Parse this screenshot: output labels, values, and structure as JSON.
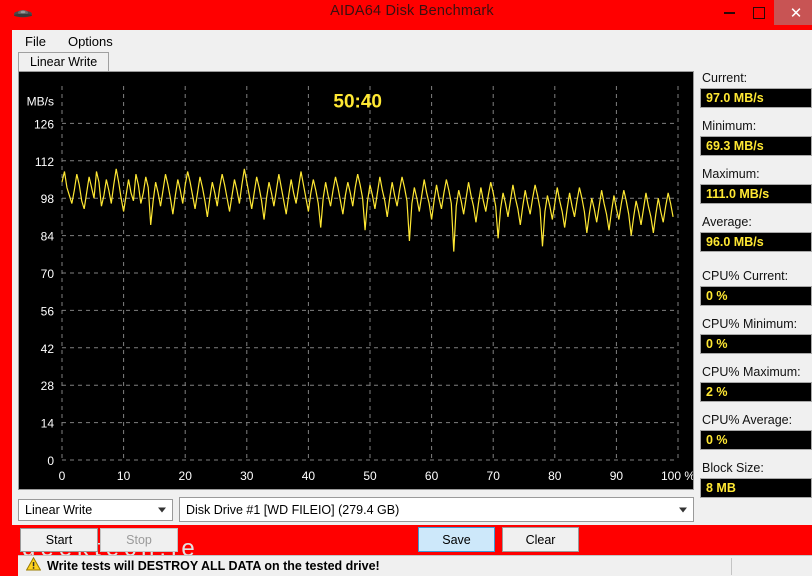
{
  "window": {
    "title": "AIDA64 Disk Benchmark",
    "app_icon": "aida64-icon",
    "minimize_label": "",
    "maximize_label": "",
    "close_label": "✕",
    "titlebar_color": "#ff0000",
    "close_button_color": "#c85454"
  },
  "menu": {
    "items": [
      {
        "label": "File"
      },
      {
        "label": "Options"
      }
    ]
  },
  "tabs": [
    {
      "label": "Linear Write",
      "active": true
    }
  ],
  "graph": {
    "timer": "50:40",
    "timer_color": "#ffe833",
    "plot_color": "#ffe833",
    "background_color": "#000000",
    "grid_color": "#808080",
    "axis_text_color": "#ffffff"
  },
  "chart_data": {
    "type": "line",
    "title": "",
    "xlabel": "100 %",
    "ylabel": "MB/s",
    "xlim": [
      0,
      100
    ],
    "ylim": [
      0,
      140
    ],
    "grid": true,
    "legend_position": "none",
    "xticks": [
      "0",
      "10",
      "20",
      "30",
      "40",
      "50",
      "60",
      "70",
      "80",
      "90",
      "100 %"
    ],
    "xtick_values": [
      0,
      10,
      20,
      30,
      40,
      50,
      60,
      70,
      80,
      90,
      100
    ],
    "yticks": [
      "0",
      "14",
      "28",
      "42",
      "56",
      "70",
      "84",
      "98",
      "112",
      "126"
    ],
    "ytick_values": [
      0,
      14,
      28,
      42,
      56,
      70,
      84,
      98,
      112,
      126
    ],
    "annotations": [
      {
        "text": "50:40",
        "x": 48,
        "y": 132,
        "color": "#ffe833"
      }
    ],
    "series": [
      {
        "name": "Linear Write",
        "color": "#ffe833",
        "x": [
          0,
          0.4,
          0.8,
          1.2,
          1.6,
          2,
          2.4,
          2.8,
          3.2,
          3.6,
          4,
          4.4,
          4.8,
          5.2,
          5.6,
          6,
          6.4,
          6.8,
          7.2,
          7.6,
          8,
          8.4,
          8.8,
          9.2,
          9.6,
          10,
          10.4,
          10.8,
          11.2,
          11.6,
          12,
          12.4,
          12.8,
          13.2,
          13.6,
          14,
          14.4,
          14.8,
          15.2,
          15.6,
          16,
          16.4,
          16.8,
          17.2,
          17.6,
          18,
          18.4,
          18.8,
          19.2,
          19.6,
          20,
          20.4,
          20.8,
          21.2,
          21.6,
          22,
          22.4,
          22.8,
          23.2,
          23.6,
          24,
          24.4,
          24.8,
          25.2,
          25.6,
          26,
          26.4,
          26.8,
          27.2,
          27.6,
          28,
          28.4,
          28.8,
          29.2,
          29.6,
          30,
          30.4,
          30.8,
          31.2,
          31.6,
          32,
          32.4,
          32.8,
          33.2,
          33.6,
          34,
          34.4,
          34.8,
          35.2,
          35.6,
          36,
          36.4,
          36.8,
          37.2,
          37.6,
          38,
          38.4,
          38.8,
          39.2,
          39.6,
          40,
          40.4,
          40.8,
          41.2,
          41.6,
          42,
          42.4,
          42.8,
          43.2,
          43.6,
          44,
          44.4,
          44.8,
          45.2,
          45.6,
          46,
          46.4,
          46.8,
          47.2,
          47.6,
          48,
          48.4,
          48.8,
          49.2,
          49.6,
          50,
          50.4,
          50.8,
          51.2,
          51.6,
          52,
          52.4,
          52.8,
          53.2,
          53.6,
          54,
          54.4,
          54.8,
          55.2,
          55.6,
          56,
          56.4,
          56.8,
          57.2,
          57.6,
          58,
          58.4,
          58.8,
          59.2,
          59.6,
          60,
          60.4,
          60.8,
          61.2,
          61.6,
          62,
          62.4,
          62.8,
          63.2,
          63.6,
          64,
          64.4,
          64.8,
          65.2,
          65.6,
          66,
          66.4,
          66.8,
          67.2,
          67.6,
          68,
          68.4,
          68.8,
          69.2,
          69.6,
          70,
          70.4,
          70.8,
          71.2,
          71.6,
          72,
          72.4,
          72.8,
          73.2,
          73.6,
          74,
          74.4,
          74.8,
          75.2,
          75.6,
          76,
          76.4,
          76.8,
          77.2,
          77.6,
          78,
          78.4,
          78.8,
          79.2,
          79.6,
          80,
          80.4,
          80.8,
          81.2,
          81.6,
          82,
          82.4,
          82.8,
          83.2,
          83.6,
          84,
          84.4,
          84.8,
          85.2,
          85.6,
          86,
          86.4,
          86.8,
          87.2,
          87.6,
          88,
          88.4,
          88.8,
          89.2,
          89.6,
          90,
          90.4,
          90.8,
          91.2,
          91.6,
          92,
          92.4,
          92.8,
          93.2,
          93.6,
          94,
          94.4,
          94.8,
          95.2,
          95.6,
          96,
          96.4,
          96.8,
          97.2,
          97.6,
          98,
          98.4,
          98.8,
          99.2,
          99.6,
          100
        ],
        "y": [
          104,
          108,
          102,
          99,
          96,
          101,
          107,
          103,
          97,
          94,
          100,
          106,
          102,
          98,
          108,
          104,
          95,
          99,
          105,
          101,
          96,
          103,
          109,
          104,
          98,
          93,
          99,
          105,
          100,
          97,
          107,
          103,
          96,
          100,
          106,
          102,
          88,
          97,
          104,
          100,
          95,
          101,
          107,
          103,
          98,
          92,
          99,
          105,
          101,
          96,
          103,
          108,
          104,
          99,
          94,
          100,
          106,
          102,
          97,
          91,
          98,
          104,
          100,
          95,
          102,
          107,
          103,
          98,
          93,
          99,
          105,
          101,
          96,
          103,
          109,
          104,
          99,
          94,
          100,
          106,
          102,
          97,
          90,
          98,
          104,
          100,
          95,
          101,
          107,
          102,
          97,
          92,
          99,
          105,
          100,
          96,
          102,
          108,
          103,
          98,
          93,
          100,
          105,
          101,
          96,
          87,
          98,
          104,
          99,
          95,
          101,
          106,
          102,
          97,
          92,
          99,
          104,
          100,
          95,
          102,
          107,
          103,
          98,
          86,
          97,
          103,
          99,
          94,
          100,
          106,
          101,
          97,
          91,
          98,
          104,
          99,
          95,
          101,
          106,
          102,
          97,
          82,
          96,
          102,
          98,
          93,
          99,
          105,
          100,
          96,
          90,
          97,
          103,
          98,
          94,
          100,
          105,
          101,
          96,
          78,
          95,
          101,
          97,
          92,
          98,
          104,
          99,
          95,
          89,
          96,
          102,
          97,
          93,
          99,
          104,
          100,
          95,
          83,
          94,
          100,
          96,
          91,
          97,
          103,
          98,
          94,
          88,
          95,
          101,
          96,
          92,
          98,
          103,
          99,
          94,
          80,
          93,
          99,
          95,
          90,
          96,
          102,
          97,
          93,
          87,
          94,
          100,
          95,
          91,
          97,
          102,
          98,
          93,
          85,
          92,
          98,
          94,
          89,
          95,
          101,
          96,
          92,
          86,
          93,
          99,
          94,
          90,
          96,
          101,
          97,
          92,
          84,
          91,
          97,
          93,
          88,
          94,
          100,
          95,
          91,
          85,
          92,
          98,
          93,
          89,
          95,
          100,
          96,
          91
        ]
      }
    ]
  },
  "controls": {
    "mode_select": {
      "value": "Linear Write"
    },
    "drive_select": {
      "value": "Disk Drive #1  [WD     FILEIO]  (279.4 GB)"
    },
    "start_button": "Start",
    "stop_button": "Stop",
    "save_button": "Save",
    "clear_button": "Clear",
    "watermark": "geektech.ie"
  },
  "stats": [
    {
      "label": "Current:",
      "value": "97.0 MB/s",
      "gap_after": false
    },
    {
      "label": "Minimum:",
      "value": "69.3 MB/s",
      "gap_after": false
    },
    {
      "label": "Maximum:",
      "value": "111.0 MB/s",
      "gap_after": false
    },
    {
      "label": "Average:",
      "value": "96.0 MB/s",
      "gap_after": true
    },
    {
      "label": "CPU% Current:",
      "value": "0 %",
      "gap_after": false
    },
    {
      "label": "CPU% Minimum:",
      "value": "0 %",
      "gap_after": false
    },
    {
      "label": "CPU% Maximum:",
      "value": "2 %",
      "gap_after": false
    },
    {
      "label": "CPU% Average:",
      "value": "0 %",
      "gap_after": false
    },
    {
      "label": "Block Size:",
      "value": "8 MB",
      "gap_after": false
    }
  ],
  "statusbar": {
    "icon": "warning-triangle-icon",
    "message": "Write tests will DESTROY ALL DATA on the tested drive!"
  }
}
